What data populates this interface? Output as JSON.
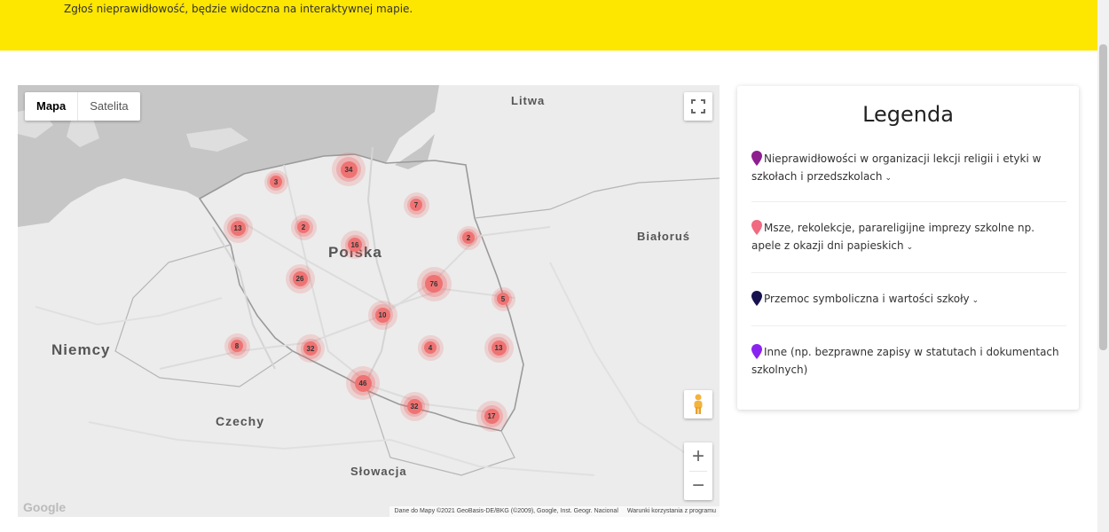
{
  "banner": {
    "text": "Zgłoś nieprawidłowość, będzie widoczna na interaktywnej mapie."
  },
  "map": {
    "type_buttons": [
      "Mapa",
      "Satelita"
    ],
    "countries": [
      "Litwa",
      "Polska",
      "Białoruś",
      "Niemcy",
      "Czechy",
      "Słowacja"
    ],
    "clusters": [
      "3",
      "34",
      "13",
      "2",
      "16",
      "7",
      "2",
      "26",
      "76",
      "5",
      "10",
      "8",
      "32",
      "4",
      "13",
      "46",
      "32",
      "17"
    ],
    "google_logo": "Google",
    "attribution": "Dane do Mapy ©2021 GeoBasis-DE/BKG (©2009), Google, Inst. Geogr. Nacional",
    "terms": "Warunki korzystania z programu",
    "zoom_in": "+",
    "zoom_out": "−",
    "icons": [
      "fullscreen-icon",
      "pegman-icon"
    ]
  },
  "legend": {
    "title": "Legenda",
    "items": [
      {
        "text": "Nieprawidłowości w organizacji lekcji religii i etyki w szkołach i przedszkolach",
        "color": "#8e1f8e"
      },
      {
        "text": "Msze, rekolekcje, parareligijne imprezy szkolne np. apele z okazji dni papieskich",
        "color": "#f06a80"
      },
      {
        "text": "Przemoc symboliczna i wartości szkoły",
        "color": "#17124e"
      },
      {
        "text": "Inne (np. bezprawne zapisy w statutach i dokumentach szkolnych)",
        "color": "#8a23f0"
      }
    ],
    "chevron": "❯"
  },
  "colors": {
    "banner": "#fde600",
    "cluster": "#ef7373",
    "sea": "#c6c6c6"
  }
}
